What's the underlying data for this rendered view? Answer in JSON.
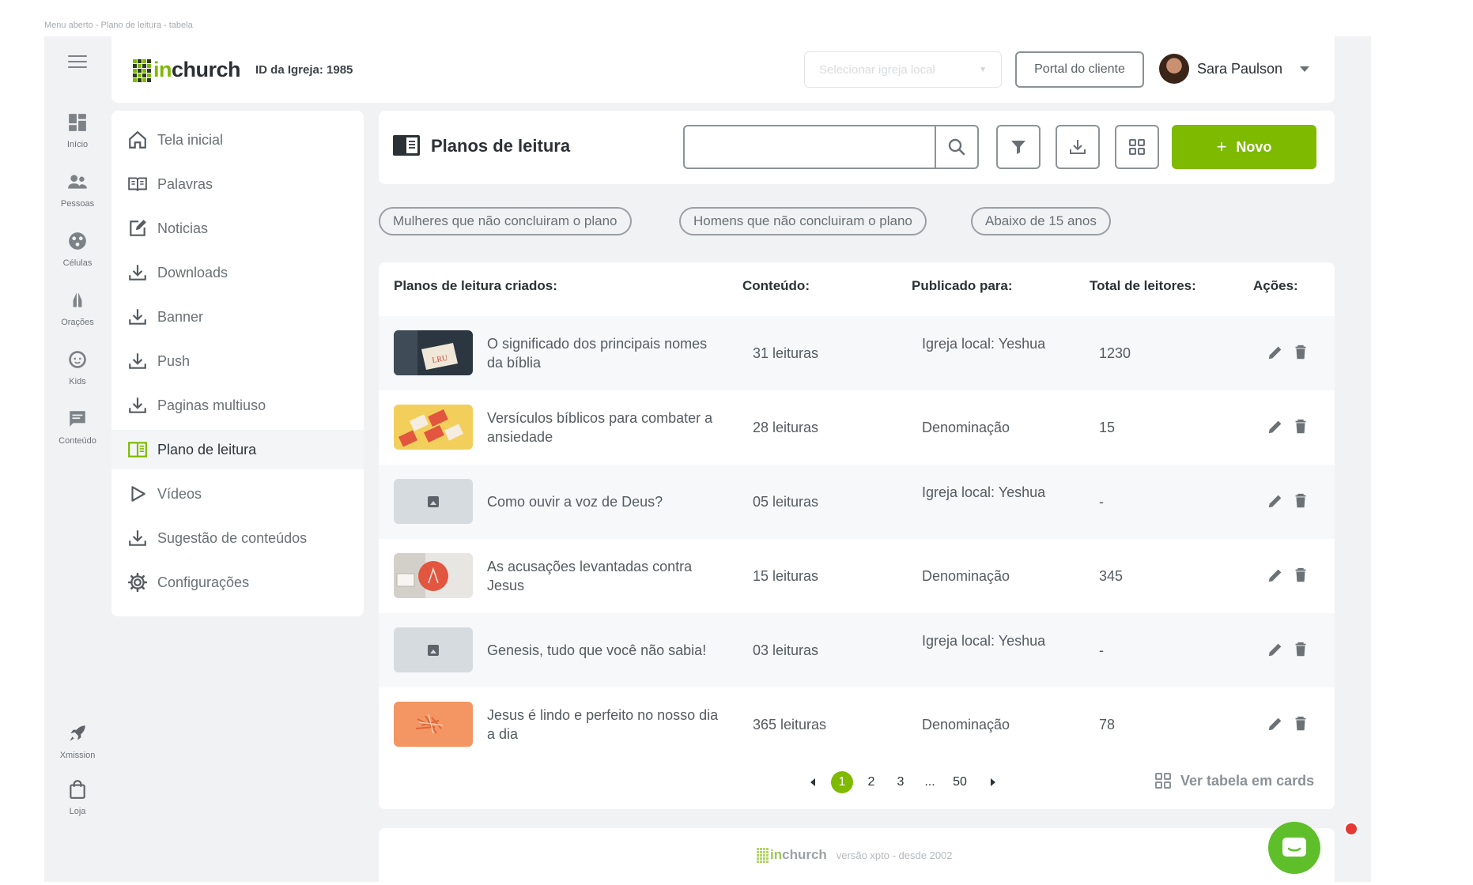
{
  "frame_caption": "Menu aberto - Plano de leitura - tabela",
  "rail": {
    "items": [
      {
        "label": "Início",
        "icon": "dashboard-icon"
      },
      {
        "label": "Pessoas",
        "icon": "people-icon"
      },
      {
        "label": "Células",
        "icon": "cells-icon"
      },
      {
        "label": "Orações",
        "icon": "praying-hands-icon"
      },
      {
        "label": "Kids",
        "icon": "child-face-icon"
      },
      {
        "label": "Conteúdo",
        "icon": "chat-content-icon"
      },
      {
        "label": "Xmission",
        "icon": "rocket-icon"
      },
      {
        "label": "Loja",
        "icon": "shopping-bag-icon"
      }
    ]
  },
  "header": {
    "logo_prefix": "in",
    "logo_suffix": "church",
    "church_id": "ID da Igreja: 1985",
    "select_placeholder": "Selecionar igreja local",
    "portal_button": "Portal do cliente",
    "user_name": "Sara Paulson"
  },
  "menu": {
    "items": [
      {
        "label": "Tela inicial",
        "icon": "home-icon"
      },
      {
        "label": "Palavras",
        "icon": "book-icon"
      },
      {
        "label": "Noticias",
        "icon": "edit-note-icon"
      },
      {
        "label": "Downloads",
        "icon": "download-icon"
      },
      {
        "label": "Banner",
        "icon": "download-icon"
      },
      {
        "label": "Push",
        "icon": "download-icon"
      },
      {
        "label": "Paginas multiuso",
        "icon": "download-icon"
      },
      {
        "label": "Plano de leitura",
        "icon": "reading-plan-icon",
        "active": true
      },
      {
        "label": "Vídeos",
        "icon": "play-icon"
      },
      {
        "label": "Sugestão de conteúdos",
        "icon": "download-icon"
      },
      {
        "label": "Configurações",
        "icon": "gear-icon"
      }
    ]
  },
  "page": {
    "title": "Planos de leitura",
    "search_value": "",
    "new_button": "Novo"
  },
  "chips": [
    "Mulheres que não concluiram o plano",
    "Homens que não concluiram o plano",
    "Abaixo de 15 anos"
  ],
  "table": {
    "headers": [
      "Planos de leitura criados:",
      "Conteúdo:",
      "Publicado para:",
      "Total de leitores:",
      "Ações:"
    ],
    "rows": [
      {
        "title": "O significado dos principais nomes da bíblia",
        "content": "31 leituras",
        "published": "Igreja local: Yeshua",
        "total": "1230",
        "thumb": "photo-sign"
      },
      {
        "title": "Versículos bíblicos para combater a ansiedade",
        "content": "28 leituras",
        "published": "Denominação",
        "total": "15",
        "thumb": "photo-cards"
      },
      {
        "title": "Como ouvir a voz de Deus?",
        "content": "05 leituras",
        "published": "Igreja local: Yeshua",
        "total": "-",
        "thumb": "placeholder"
      },
      {
        "title": "As acusações levantadas contra Jesus",
        "content": "15 leituras",
        "published": "Denominação",
        "total": "345",
        "thumb": "photo-sign-red"
      },
      {
        "title": "Genesis, tudo que você não sabia!",
        "content": "03 leituras",
        "published": "Igreja local: Yeshua",
        "total": "-",
        "thumb": "placeholder"
      },
      {
        "title": "Jesus é lindo e perfeito no nosso dia a dia",
        "content": "365 leituras",
        "published": "Denominação",
        "total": "78",
        "thumb": "photo-orange"
      }
    ]
  },
  "pagination": {
    "pages": [
      "1",
      "2",
      "3",
      "...",
      "50"
    ],
    "current": "1",
    "cards_link": "Ver tabela em cards"
  },
  "footer": {
    "logo_prefix": "in",
    "logo_suffix": "church",
    "text": "versão xpto - desde 2002"
  },
  "colors": {
    "brand_green": "#7dba00",
    "chat_green": "#5fbf2a",
    "notification_red": "#e53935"
  }
}
